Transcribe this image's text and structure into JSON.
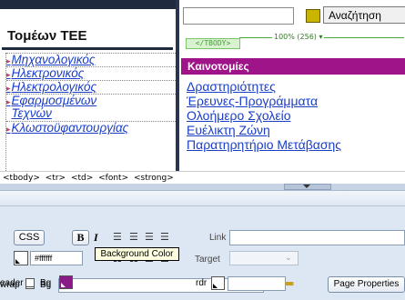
{
  "left_column": {
    "title": "Τομέων ΤΕΕ",
    "items": [
      "Μηχανολογικός",
      "Ηλεκτρονικός",
      "Ηλεκτρολογικός",
      "Εφαρμοσμένων",
      "Τεχνών",
      "Κλωστοϋφαντουργίας"
    ]
  },
  "right_column": {
    "search_button": "Αναζήτηση",
    "tbody_tag": "</TBODY>",
    "width_indicator": "100% (256) ▾",
    "section_title": "Καινοτομίες",
    "links": [
      "Δραστηριότητες",
      "Έρευνες-Προγράμματα",
      "Ολοήμερο Σχολείο",
      "Ευέλικτη Ζώνη",
      "Παρατηρητήριο Μετάβασης"
    ]
  },
  "tag_selector": [
    "<tbody>",
    "<tr>",
    "<td>",
    "<font>",
    "<strong>"
  ],
  "properties": {
    "css_button": "CSS",
    "bold": "B",
    "italic": "I",
    "link_label": "Link",
    "link_value": "",
    "color_value": "#ffffff",
    "target_label": "Target",
    "wrap_label": "wrap",
    "bg_label": "Bg",
    "bg_value": "",
    "page_properties": "Page Properties",
    "header_label": "eader",
    "brdr_label": "rdr",
    "bg_color": "#8a1a86",
    "tooltip": "Background Color"
  },
  "icons": [
    "search-icon",
    "align-left-icon",
    "align-center-icon",
    "align-right-icon",
    "justify-icon",
    "unordered-list-icon",
    "ordered-list-icon",
    "outdent-icon",
    "indent-icon",
    "point-to-file-icon",
    "folder-icon"
  ],
  "colors": {
    "dark_bar": "#1f2a3e",
    "magenta": "#a0148a",
    "link": "#1a3ec8",
    "panel": "#dde7f3"
  }
}
